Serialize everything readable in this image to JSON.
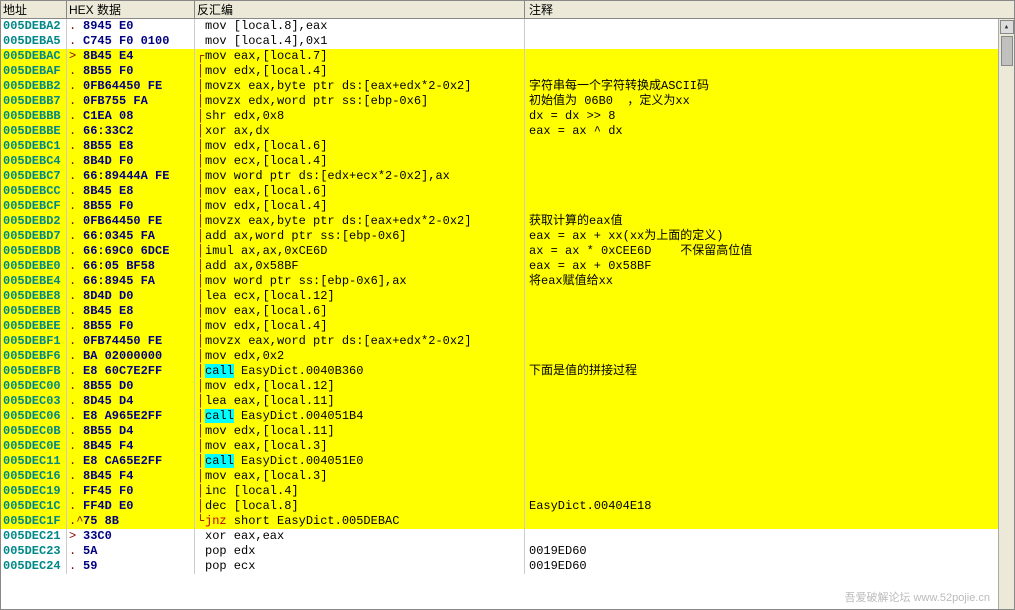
{
  "header": {
    "addr": "地址",
    "hex": "HEX 数据",
    "dis": "反汇编",
    "cmt": "注释"
  },
  "watermark": "吾爱破解论坛\nwww.52pojie.cn",
  "rows": [
    {
      "addr": "005DEBA2",
      "mk": ".",
      "hex": "8945 E0",
      "ar": "",
      "dis": "mov [local.8],eax",
      "cmt": "",
      "hl": false
    },
    {
      "addr": "005DEBA5",
      "mk": ".",
      "hex": "C745 F0 0100",
      "ar": "",
      "dis": "mov [local.4],0x1",
      "cmt": "",
      "hl": false
    },
    {
      "addr": "005DEBAC",
      "mk": ">",
      "hex": "8B45 E4",
      "ar": "┌",
      "dis": "mov eax,[local.7]",
      "cmt": "",
      "hl": true,
      "jt": true
    },
    {
      "addr": "005DEBAF",
      "mk": ".",
      "hex": "8B55 F0",
      "ar": "│",
      "dis": "mov edx,[local.4]",
      "cmt": "",
      "hl": true
    },
    {
      "addr": "005DEBB2",
      "mk": ".",
      "hex": "0FB64450 FE",
      "ar": "│",
      "dis": "movzx eax,byte ptr ds:[eax+edx*2-0x2]",
      "cmt": "字符串每一个字符转换成ASCII码",
      "hl": true
    },
    {
      "addr": "005DEBB7",
      "mk": ".",
      "hex": "0FB755 FA",
      "ar": "│",
      "dis": "movzx edx,word ptr ss:[ebp-0x6]",
      "cmt": "初始值为 06B0  ，定义为xx",
      "hl": true
    },
    {
      "addr": "005DEBBB",
      "mk": ".",
      "hex": "C1EA 08",
      "ar": "│",
      "dis": "shr edx,0x8",
      "cmt": "dx = dx >> 8",
      "hl": true
    },
    {
      "addr": "005DEBBE",
      "mk": ".",
      "hex": "66:33C2",
      "ar": "│",
      "dis": "xor ax,dx",
      "cmt": "eax = ax ^ dx",
      "hl": true
    },
    {
      "addr": "005DEBC1",
      "mk": ".",
      "hex": "8B55 E8",
      "ar": "│",
      "dis": "mov edx,[local.6]",
      "cmt": "",
      "hl": true
    },
    {
      "addr": "005DEBC4",
      "mk": ".",
      "hex": "8B4D F0",
      "ar": "│",
      "dis": "mov ecx,[local.4]",
      "cmt": "",
      "hl": true
    },
    {
      "addr": "005DEBC7",
      "mk": ".",
      "hex": "66:89444A FE",
      "ar": "│",
      "dis": "mov word ptr ds:[edx+ecx*2-0x2],ax",
      "cmt": "",
      "hl": true
    },
    {
      "addr": "005DEBCC",
      "mk": ".",
      "hex": "8B45 E8",
      "ar": "│",
      "dis": "mov eax,[local.6]",
      "cmt": "",
      "hl": true
    },
    {
      "addr": "005DEBCF",
      "mk": ".",
      "hex": "8B55 F0",
      "ar": "│",
      "dis": "mov edx,[local.4]",
      "cmt": "",
      "hl": true
    },
    {
      "addr": "005DEBD2",
      "mk": ".",
      "hex": "0FB64450 FE",
      "ar": "│",
      "dis": "movzx eax,byte ptr ds:[eax+edx*2-0x2]",
      "cmt": "获取计算的eax值",
      "hl": true
    },
    {
      "addr": "005DEBD7",
      "mk": ".",
      "hex": "66:0345 FA",
      "ar": "│",
      "dis": "add ax,word ptr ss:[ebp-0x6]",
      "cmt": "eax = ax + xx(xx为上面的定义)",
      "hl": true
    },
    {
      "addr": "005DEBDB",
      "mk": ".",
      "hex": "66:69C0 6DCE",
      "ar": "│",
      "dis": "imul ax,ax,0xCE6D",
      "cmt": "ax = ax * 0xCEE6D    不保留高位值",
      "hl": true
    },
    {
      "addr": "005DEBE0",
      "mk": ".",
      "hex": "66:05 BF58",
      "ar": "│",
      "dis": "add ax,0x58BF",
      "cmt": "eax = ax + 0x58BF",
      "hl": true
    },
    {
      "addr": "005DEBE4",
      "mk": ".",
      "hex": "66:8945 FA",
      "ar": "│",
      "dis": "mov word ptr ss:[ebp-0x6],ax",
      "cmt": "将eax赋值给xx",
      "hl": true
    },
    {
      "addr": "005DEBE8",
      "mk": ".",
      "hex": "8D4D D0",
      "ar": "│",
      "dis": "lea ecx,[local.12]",
      "cmt": "",
      "hl": true
    },
    {
      "addr": "005DEBEB",
      "mk": ".",
      "hex": "8B45 E8",
      "ar": "│",
      "dis": "mov eax,[local.6]",
      "cmt": "",
      "hl": true
    },
    {
      "addr": "005DEBEE",
      "mk": ".",
      "hex": "8B55 F0",
      "ar": "│",
      "dis": "mov edx,[local.4]",
      "cmt": "",
      "hl": true
    },
    {
      "addr": "005DEBF1",
      "mk": ".",
      "hex": "0FB74450 FE",
      "ar": "│",
      "dis": "movzx eax,word ptr ds:[eax+edx*2-0x2]",
      "cmt": "",
      "hl": true
    },
    {
      "addr": "005DEBF6",
      "mk": ".",
      "hex": "BA 02000000",
      "ar": "│",
      "dis": "mov edx,0x2",
      "cmt": "",
      "hl": true
    },
    {
      "addr": "005DEBFB",
      "mk": ".",
      "hex": "E8 60C7E2FF",
      "ar": "│",
      "dis": "call EasyDict.0040B360",
      "cmt": "下面是值的拼接过程",
      "hl": true,
      "call": true
    },
    {
      "addr": "005DEC00",
      "mk": ".",
      "hex": "8B55 D0",
      "ar": "│",
      "dis": "mov edx,[local.12]",
      "cmt": "",
      "hl": true
    },
    {
      "addr": "005DEC03",
      "mk": ".",
      "hex": "8D45 D4",
      "ar": "│",
      "dis": "lea eax,[local.11]",
      "cmt": "",
      "hl": true
    },
    {
      "addr": "005DEC06",
      "mk": ".",
      "hex": "E8 A965E2FF",
      "ar": "│",
      "dis": "call EasyDict.004051B4",
      "cmt": "",
      "hl": true,
      "call": true
    },
    {
      "addr": "005DEC0B",
      "mk": ".",
      "hex": "8B55 D4",
      "ar": "│",
      "dis": "mov edx,[local.11]",
      "cmt": "",
      "hl": true
    },
    {
      "addr": "005DEC0E",
      "mk": ".",
      "hex": "8B45 F4",
      "ar": "│",
      "dis": "mov eax,[local.3]",
      "cmt": "",
      "hl": true
    },
    {
      "addr": "005DEC11",
      "mk": ".",
      "hex": "E8 CA65E2FF",
      "ar": "│",
      "dis": "call EasyDict.004051E0",
      "cmt": "",
      "hl": true,
      "call": true
    },
    {
      "addr": "005DEC16",
      "mk": ".",
      "hex": "8B45 F4",
      "ar": "│",
      "dis": "mov eax,[local.3]",
      "cmt": "",
      "hl": true
    },
    {
      "addr": "005DEC19",
      "mk": ".",
      "hex": "FF45 F0",
      "ar": "│",
      "dis": "inc [local.4]",
      "cmt": "",
      "hl": true
    },
    {
      "addr": "005DEC1C",
      "mk": ".",
      "hex": "FF4D E0",
      "ar": "│",
      "dis": "dec [local.8]",
      "cmt": "EasyDict.00404E18",
      "hl": true
    },
    {
      "addr": "005DEC1F",
      "mk": ".^",
      "hex": "75 8B",
      "ar": "└",
      "dis": "jnz short EasyDict.005DEBAC",
      "cmt": "",
      "hl": true,
      "jnz": true
    },
    {
      "addr": "005DEC21",
      "mk": ">",
      "hex": "33C0",
      "ar": "",
      "dis": "xor eax,eax",
      "cmt": "",
      "hl": false
    },
    {
      "addr": "005DEC23",
      "mk": ".",
      "hex": "5A",
      "ar": "",
      "dis": "pop edx",
      "cmt": "0019ED60",
      "hl": false
    },
    {
      "addr": "005DEC24",
      "mk": ".",
      "hex": "59",
      "ar": "",
      "dis": "pop ecx",
      "cmt": "0019ED60",
      "hl": false
    }
  ]
}
